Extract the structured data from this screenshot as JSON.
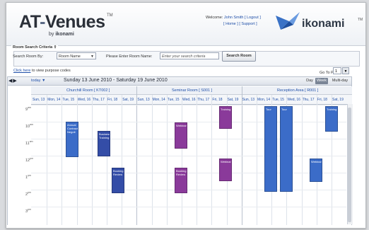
{
  "app": {
    "title": "AT-Venues",
    "title_at": "AT",
    "title_dash": "-",
    "title_rest": "Venues",
    "tm": "TM",
    "subtitle_by": "by",
    "subtitle_brand": "ikonami",
    "brand": "ikonami",
    "brand_tm": "TM"
  },
  "user": {
    "welcome_prefix": "Welcome:",
    "name": "John Smith",
    "logout": "Logout",
    "home": "Home",
    "support": "Support"
  },
  "search": {
    "legend": "Room Search Criteria",
    "search_by_label": "Search Room By:",
    "search_by_value": "Room Name",
    "name_label": "Please Enter Room Name:",
    "placeholder": "Enter your search criteria",
    "button": "Search Room"
  },
  "links": {
    "purpose_link": "Click here",
    "purpose_rest": "to view purpose codes",
    "goto_label": "Go To Page",
    "goto_value": "1"
  },
  "toolbar": {
    "today": "today",
    "date_range": "Sunday 13 June 2010 - Saturday 19 June 2010",
    "views": [
      "Day",
      "Week",
      "Multi-day"
    ],
    "active_view": "Week"
  },
  "rooms": [
    "Churchill Room [ KT002 ]",
    "Seminar Room [ S001 ]",
    "Reception Area [ R001 ]"
  ],
  "days": [
    [
      "Sun, 13",
      "Mon, 14",
      "Tue, 15",
      "Wed, 16",
      "Thu, 17",
      "Fri, 18",
      "Sat, 19"
    ],
    [
      "Sun, 13",
      "Mon, 14",
      "Tue, 15",
      "Wed, 16",
      "Thu, 17",
      "Fri, 18",
      "Sat, 19"
    ],
    [
      "Sun, 13",
      "Mon, 14",
      "Tue, 15",
      "Wed, 16",
      "Thu, 17",
      "Fri, 18",
      "Sat, 19"
    ]
  ],
  "times": [
    "9",
    "10",
    "11",
    "12",
    "1",
    "2",
    "3"
  ],
  "time_suffixes": [
    "am",
    "am",
    "am",
    "pm",
    "pm",
    "pm",
    "pm"
  ],
  "events": [
    {
      "label": "Annual Contract Negoti",
      "color": "blue"
    },
    {
      "label": "Business Training",
      "color": "darkblue"
    },
    {
      "label": "Booking Review",
      "color": "darkblue"
    },
    {
      "label": "Webinar",
      "color": "purple"
    },
    {
      "label": "Booking Review",
      "color": "purple"
    },
    {
      "label": "Training",
      "color": "purple"
    },
    {
      "label": "Webinar",
      "color": "purple"
    },
    {
      "label": "Tour",
      "color": "blue"
    },
    {
      "label": "Tour",
      "color": "blue"
    },
    {
      "label": "Webinar",
      "color": "blue"
    },
    {
      "label": "Training",
      "color": "blue"
    }
  ],
  "colors": {
    "blue": "#3b6cc8",
    "darkblue": "#344da7",
    "purple": "#8a3a9a"
  }
}
